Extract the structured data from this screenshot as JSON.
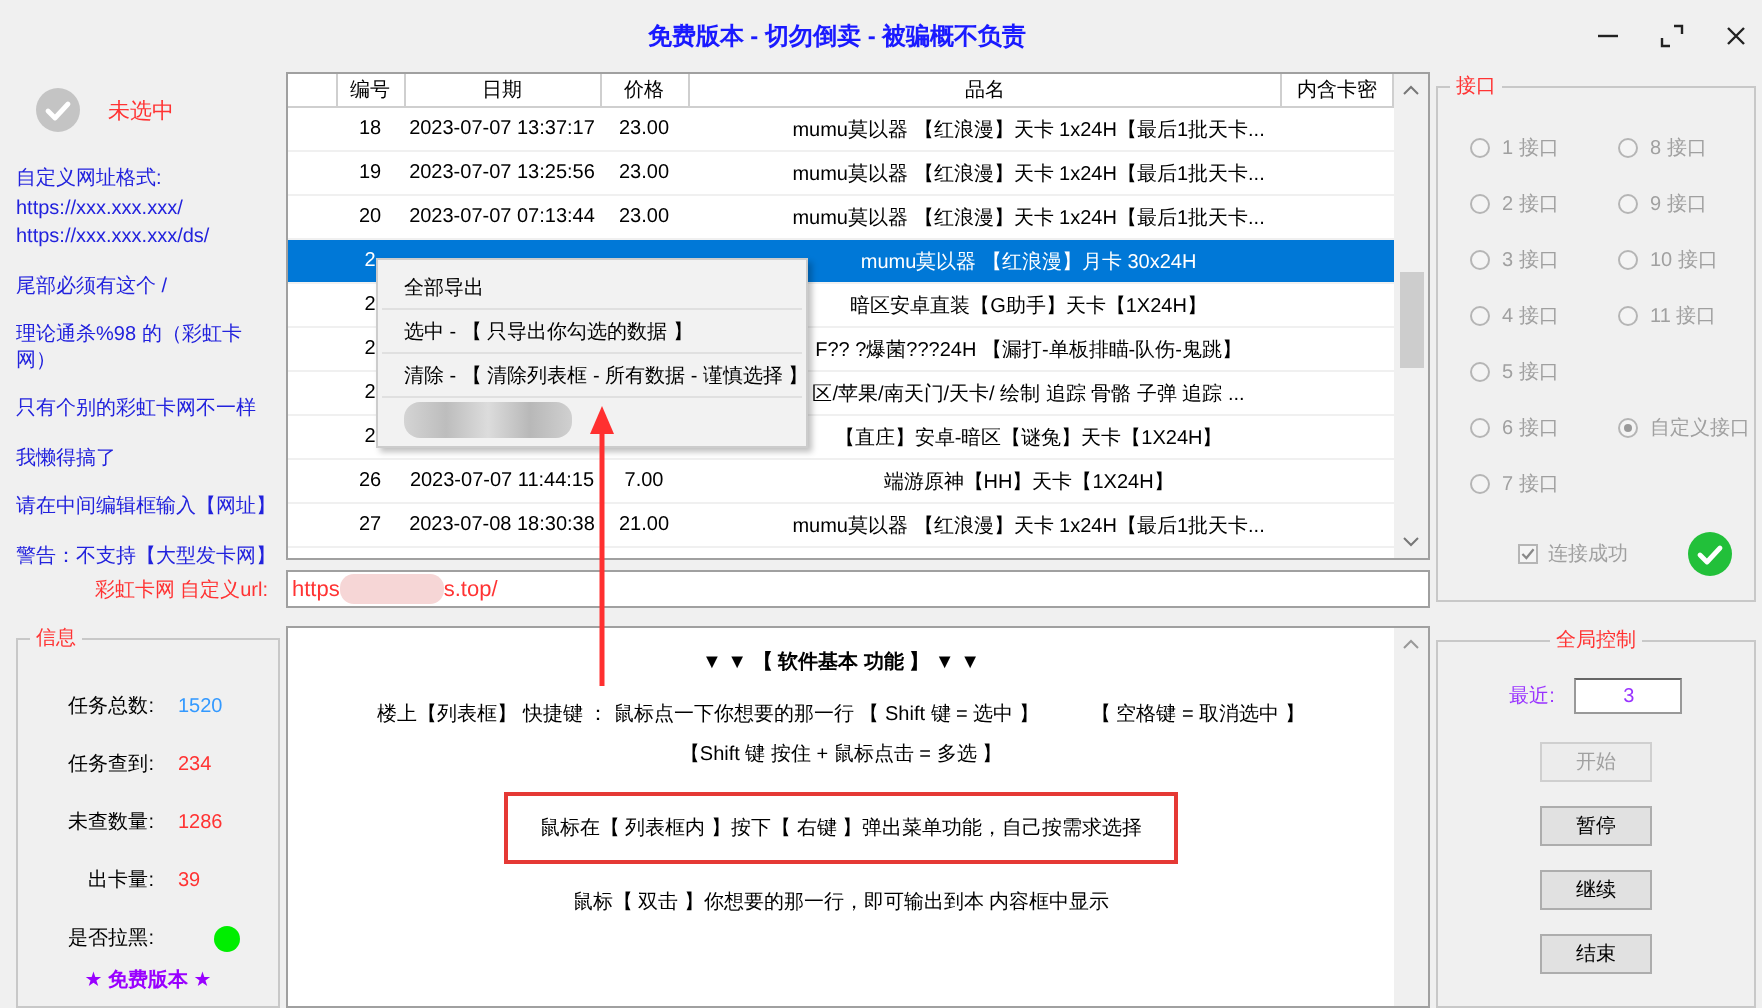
{
  "window": {
    "title": "免费版本 - 切勿倒卖 - 被骗概不负责"
  },
  "status": {
    "label": "未选中",
    "checked": false
  },
  "notes": [
    [
      "自定义网址格式:",
      "https://xxx.xxx.xxx/",
      "https://xxx.xxx.xxx/ds/"
    ],
    [
      "尾部必须有这个 /"
    ],
    [
      "理论通杀%98 的（彩虹卡网）"
    ],
    [
      "只有个别的彩虹卡网不一样"
    ],
    [
      "我懒得搞了"
    ],
    [
      "请在中间编辑框输入【网址】"
    ],
    [
      "警告：不支持【大型发卡网】"
    ]
  ],
  "table": {
    "columns": [
      "编号",
      "日期",
      "价格",
      "品名",
      "内含卡密"
    ],
    "rows": [
      {
        "number": "18",
        "date": "2023-07-07 13:37:17",
        "price": "23.00",
        "name": "mumu莫以器 【红浪漫】天卡 1x24H【最后1批天卡...",
        "selected": false
      },
      {
        "number": "19",
        "date": "2023-07-07 13:25:56",
        "price": "23.00",
        "name": "mumu莫以器 【红浪漫】天卡 1x24H【最后1批天卡...",
        "selected": false
      },
      {
        "number": "20",
        "date": "2023-07-07 07:13:44",
        "price": "23.00",
        "name": "mumu莫以器 【红浪漫】天卡 1x24H【最后1批天卡...",
        "selected": false
      },
      {
        "number": "2",
        "name": "mumu莫以器 【红浪漫】月卡 30x24H",
        "selected": true
      },
      {
        "number": "2",
        "name": "暗区安卓直装【G助手】天卡【1X24H】",
        "selected": false
      },
      {
        "number": "2",
        "name": "F?? ?爆菌???24H 【漏打-单板排瞄-队伤-鬼跳】",
        "selected": false
      },
      {
        "number": "2",
        "name": "区/苹果/南天门/天卡/ 绘制 追踪 骨骼 子弹 追踪 ...",
        "selected": false
      },
      {
        "number": "2",
        "name": "【直庄】安卓-暗区【谜兔】天卡【1X24H】",
        "selected": false
      },
      {
        "number": "26",
        "date": "2023-07-07 11:44:15",
        "price": "7.00",
        "name": "端游原神【HH】天卡【1X24H】",
        "selected": false
      },
      {
        "number": "27",
        "date": "2023-07-08 18:30:38",
        "price": "21.00",
        "name": "mumu莫以器 【红浪漫】天卡 1x24H【最后1批天卡...",
        "selected": false
      }
    ]
  },
  "context_menu": {
    "items": [
      {
        "kind": "text",
        "label": "全部导出"
      },
      {
        "kind": "text",
        "label": "选中 - 【 只导出你勾选的数据 】"
      },
      {
        "kind": "text",
        "label": "清除 - 【 清除列表框 - 所有数据 - 谨慎选择 】"
      },
      {
        "kind": "redacted"
      }
    ]
  },
  "url": {
    "label": "彩虹卡网 自定义url:",
    "value_start": "https",
    "value_end": "s.top/"
  },
  "info": {
    "title": "信息",
    "stats": [
      {
        "kind": "value",
        "label": "任务总数:",
        "value": "1520",
        "color": "#3399ff"
      },
      {
        "kind": "value",
        "label": "任务查到:",
        "value": "234",
        "color": "#ff3333"
      },
      {
        "kind": "value",
        "label": "未查数量:",
        "value": "1286",
        "color": "#ff3333"
      },
      {
        "kind": "value",
        "label": "出卡量:",
        "value": "39",
        "color": "#ff3333"
      },
      {
        "kind": "dot",
        "label": "是否拉黑:",
        "color": "#00ee00"
      }
    ],
    "footer": "★ 免费版本 ★"
  },
  "help": {
    "heading": "▼ ▼ 【 软件基本 功能 】 ▼ ▼",
    "lines": [
      {
        "kind": "plain",
        "segments": [
          "楼上【列表框】 快捷键 ： 鼠标点一下你想要的那一行 【 Shift 键 = 选中 】",
          "【 空格键 = 取消选中 】",
          "【Shift 键 按住 + 鼠标点击 = 多选 】"
        ]
      },
      {
        "kind": "highlighted",
        "segments": [
          "鼠标在【 列表框内 】按下【 右键 】弹出菜单功能，自己按需求选择"
        ]
      },
      {
        "kind": "plain",
        "segments": [
          "鼠标【 双击 】你想要的那一行，即可输出到本 内容框中显示"
        ]
      }
    ]
  },
  "ports": {
    "title": "接口",
    "options": [
      {
        "label": "1 接口",
        "selected": false,
        "disabled": true
      },
      {
        "label": "2 接口",
        "selected": false,
        "disabled": true
      },
      {
        "label": "3 接口",
        "selected": false,
        "disabled": true
      },
      {
        "label": "4 接口",
        "selected": false,
        "disabled": true
      },
      {
        "label": "5 接口",
        "selected": false,
        "disabled": true
      },
      {
        "label": "6 接口",
        "selected": false,
        "disabled": true
      },
      {
        "label": "7 接口",
        "selected": false,
        "disabled": true
      },
      {
        "label": "8 接口",
        "selected": false,
        "disabled": true
      },
      {
        "label": "9 接口",
        "selected": false,
        "disabled": true
      },
      {
        "label": "10 接口",
        "selected": false,
        "disabled": true
      },
      {
        "label": "11 接口",
        "selected": false,
        "disabled": true
      },
      {
        "label": "自定义接口",
        "selected": true,
        "disabled": true
      }
    ],
    "connection": {
      "label": "连接成功",
      "checked": true,
      "disabled": true
    }
  },
  "control": {
    "title": "全局控制",
    "recent_label": "最近:",
    "recent_value": "3",
    "buttons": [
      {
        "label": "开始",
        "disabled": true
      },
      {
        "label": "暂停",
        "disabled": false
      },
      {
        "label": "继续",
        "disabled": false
      },
      {
        "label": "结束",
        "disabled": false
      }
    ]
  }
}
